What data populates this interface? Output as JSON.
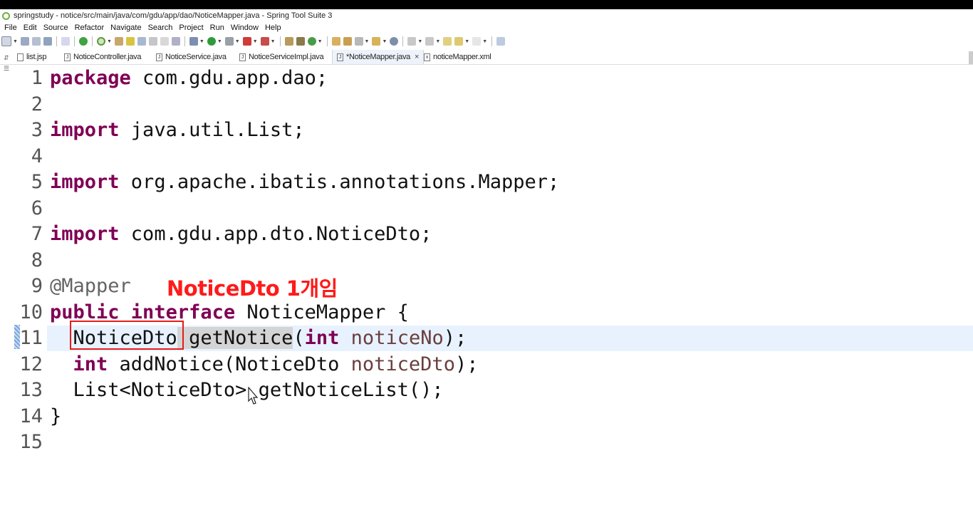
{
  "window": {
    "title": "springstudy - notice/src/main/java/com/gdu/app/dao/NoticeMapper.java - Spring Tool Suite 3"
  },
  "menu": [
    "File",
    "Edit",
    "Source",
    "Refactor",
    "Navigate",
    "Search",
    "Project",
    "Run",
    "Window",
    "Help"
  ],
  "tabs": [
    {
      "label": "list.jsp",
      "icon": "file-icon"
    },
    {
      "label": "NoticeController.java",
      "icon": "java-file-icon"
    },
    {
      "label": "NoticeService.java",
      "icon": "java-file-icon"
    },
    {
      "label": "NoticeServiceImpl.java",
      "icon": "java-file-icon"
    },
    {
      "label": "*NoticeMapper.java",
      "icon": "java-file-icon",
      "active": true
    },
    {
      "label": "noticeMapper.xml",
      "icon": "xml-file-icon"
    }
  ],
  "code": {
    "lines": [
      {
        "n": "1",
        "parts": [
          [
            "kw",
            "package"
          ],
          [
            "",
            "com.gdu.app.dao;"
          ]
        ]
      },
      {
        "n": "2",
        "parts": []
      },
      {
        "n": "3",
        "parts": [
          [
            "kw",
            "import"
          ],
          [
            "",
            "java.util.List;"
          ]
        ]
      },
      {
        "n": "4",
        "parts": []
      },
      {
        "n": "5",
        "parts": [
          [
            "kw",
            "import"
          ],
          [
            "",
            "org.apache.ibatis.annotations.Mapper;"
          ]
        ]
      },
      {
        "n": "6",
        "parts": []
      },
      {
        "n": "7",
        "parts": [
          [
            "kw",
            "import"
          ],
          [
            "",
            "com.gdu.app.dto.NoticeDto;"
          ]
        ]
      },
      {
        "n": "8",
        "parts": []
      },
      {
        "n": "9",
        "parts": [
          [
            "ann",
            "@Mapper"
          ]
        ]
      },
      {
        "n": "10",
        "parts": [
          [
            "kw",
            "public"
          ],
          [
            "kw",
            "interface"
          ],
          [
            "",
            "NoticeMapper {"
          ]
        ]
      },
      {
        "n": "11",
        "parts": [
          [
            "",
            "  NoticeDto"
          ],
          [
            "occ",
            "getNotice"
          ],
          [
            "",
            "("
          ],
          [
            "kw",
            "int"
          ],
          [
            "var",
            "noticeNo"
          ],
          [
            "",
            ");"
          ]
        ]
      },
      {
        "n": "12",
        "parts": [
          [
            "kw",
            "  int"
          ],
          [
            "",
            "addNotice(NoticeDto"
          ],
          [
            "var",
            "noticeDto"
          ],
          [
            "",
            ");"
          ]
        ]
      },
      {
        "n": "13",
        "parts": [
          [
            "",
            "  List<NoticeDto> getNoticeList();"
          ]
        ]
      },
      {
        "n": "14",
        "parts": [
          [
            "",
            "}"
          ]
        ]
      },
      {
        "n": "15",
        "parts": []
      }
    ]
  },
  "annotation": {
    "text": "NoticeDto 1개임",
    "color": "#ff1a1a"
  },
  "colors": {
    "keyword": "#7f0055",
    "annotation_gray": "#646464",
    "variable": "#6a3e3e",
    "current_line": "#e8f2fe"
  }
}
